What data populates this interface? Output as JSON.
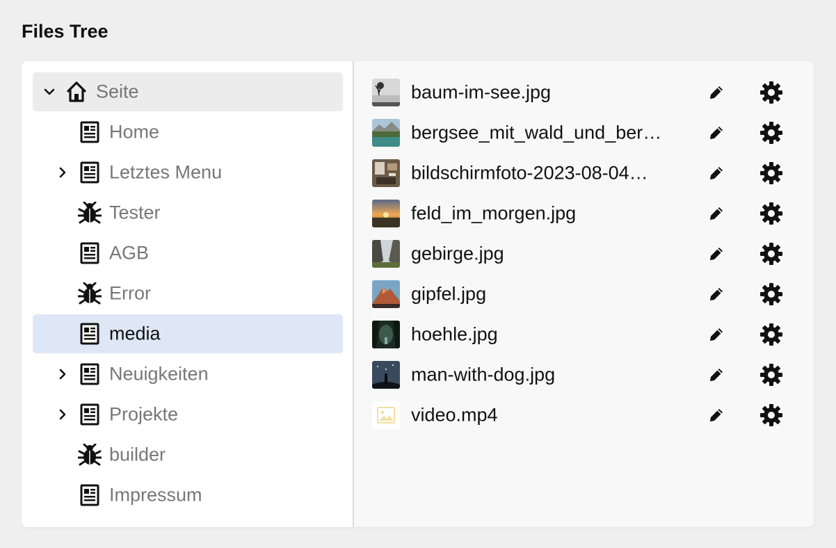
{
  "page": {
    "title": "Files Tree"
  },
  "tree": {
    "root": {
      "label": "Seite",
      "icon": "home-icon",
      "expanded": true
    },
    "items": [
      {
        "label": "Home",
        "icon": "page-icon",
        "expandable": false,
        "selected": false
      },
      {
        "label": "Letztes Menu",
        "icon": "page-icon",
        "expandable": true,
        "selected": false
      },
      {
        "label": "Tester",
        "icon": "bug-icon",
        "expandable": false,
        "selected": false
      },
      {
        "label": "AGB",
        "icon": "page-icon",
        "expandable": false,
        "selected": false
      },
      {
        "label": "Error",
        "icon": "bug-icon",
        "expandable": false,
        "selected": false
      },
      {
        "label": "media",
        "icon": "page-icon",
        "expandable": false,
        "selected": true
      },
      {
        "label": "Neuigkeiten",
        "icon": "page-icon",
        "expandable": true,
        "selected": false
      },
      {
        "label": "Projekte",
        "icon": "page-icon",
        "expandable": true,
        "selected": false
      },
      {
        "label": "builder",
        "icon": "bug-icon",
        "expandable": false,
        "selected": false
      },
      {
        "label": "Impressum",
        "icon": "page-icon",
        "expandable": false,
        "selected": false
      }
    ]
  },
  "files": [
    {
      "name": "baum-im-see.jpg",
      "thumb": "tree-lake"
    },
    {
      "name": "bergsee_mit_wald_und_ber…",
      "thumb": "mountain-lake"
    },
    {
      "name": "bildschirmfoto-2023-08-04…",
      "thumb": "screenshot"
    },
    {
      "name": "feld_im_morgen.jpg",
      "thumb": "sunrise-field"
    },
    {
      "name": "gebirge.jpg",
      "thumb": "valley"
    },
    {
      "name": "gipfel.jpg",
      "thumb": "peak"
    },
    {
      "name": "hoehle.jpg",
      "thumb": "cave"
    },
    {
      "name": "man-with-dog.jpg",
      "thumb": "night-sky"
    },
    {
      "name": "video.mp4",
      "thumb": "placeholder"
    }
  ],
  "colors": {
    "background": "#efefef",
    "panel": "#ffffff",
    "selected_row": "#dde7f5",
    "root_row": "#ececec",
    "muted_text": "#777777"
  }
}
